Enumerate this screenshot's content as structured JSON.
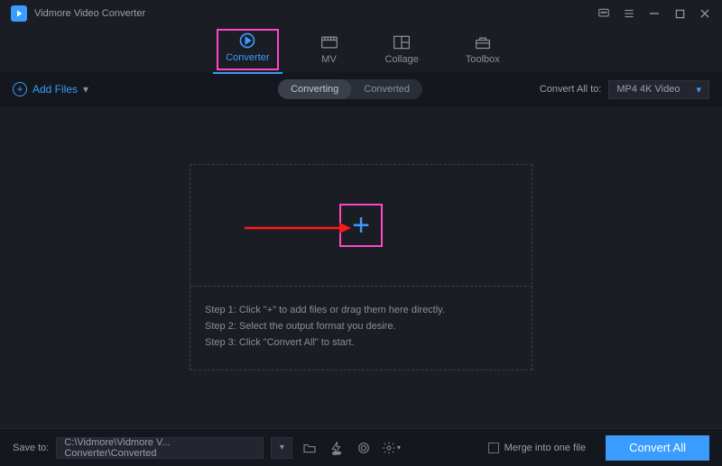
{
  "app": {
    "title": "Vidmore Video Converter"
  },
  "tabs": {
    "converter": "Converter",
    "mv": "MV",
    "collage": "Collage",
    "toolbox": "Toolbox"
  },
  "toolbar": {
    "add_files": "Add Files",
    "segment_converting": "Converting",
    "segment_converted": "Converted",
    "convert_all_to_label": "Convert All to:",
    "format_selected": "MP4 4K Video"
  },
  "dropzone": {
    "step1": "Step 1: Click \"+\" to add files or drag them here directly.",
    "step2": "Step 2: Select the output format you desire.",
    "step3": "Step 3: Click \"Convert All\" to start."
  },
  "footer": {
    "save_to_label": "Save to:",
    "save_path": "C:\\Vidmore\\Vidmore V... Converter\\Converted",
    "merge_label": "Merge into one file",
    "convert_all_btn": "Convert All"
  }
}
